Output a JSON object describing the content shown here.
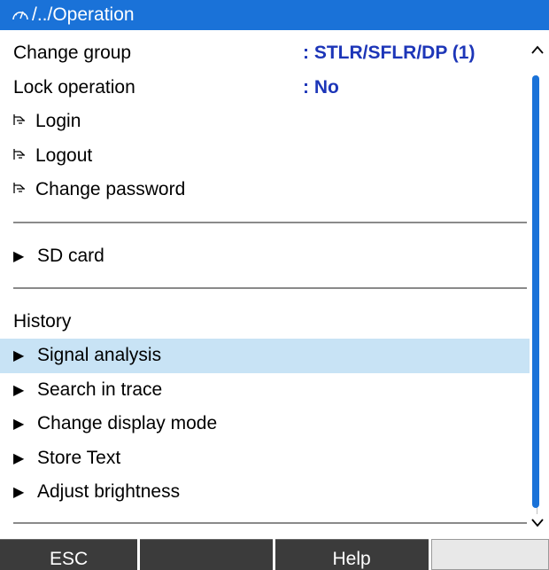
{
  "header": {
    "path": "/../Operation"
  },
  "rows_top": [
    {
      "label": "Change group",
      "value": ": STLR/SFLR/DP (1)"
    },
    {
      "label": "Lock operation",
      "value": ": No"
    }
  ],
  "action_items": [
    {
      "label": "Login",
      "icon": "login-hand-icon"
    },
    {
      "label": "Logout",
      "icon": "login-hand-icon"
    },
    {
      "label": "Change password",
      "icon": "login-hand-icon"
    }
  ],
  "sd_card": {
    "label": "SD card",
    "icon": "submenu-arrow-icon"
  },
  "history": {
    "heading": "History",
    "items": [
      {
        "label": "Signal analysis",
        "selected": true
      },
      {
        "label": "Search in trace"
      },
      {
        "label": "Change display mode"
      },
      {
        "label": "Store Text"
      },
      {
        "label": "Adjust brightness"
      }
    ]
  },
  "softkeys": [
    {
      "label": "ESC"
    },
    {
      "label": ""
    },
    {
      "label": "Help"
    },
    {
      "label": ""
    }
  ],
  "colors": {
    "titlebar": "#1a72d8",
    "value_text": "#1d36b8",
    "selected_row": "#c8e3f5",
    "softkey_bg": "#3b3b3b"
  }
}
